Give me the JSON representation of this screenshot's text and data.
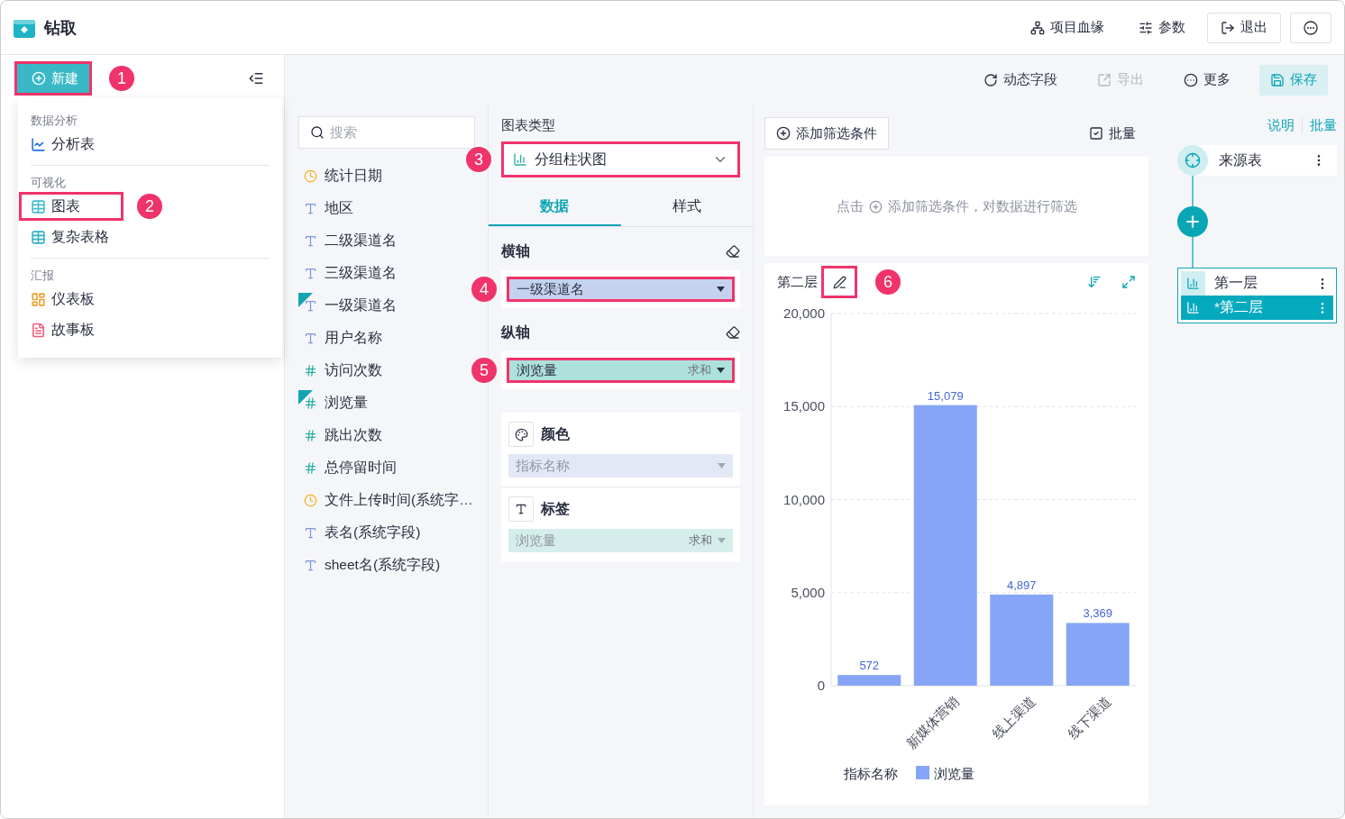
{
  "window": {
    "title": "钻取"
  },
  "header_actions": [
    {
      "kind": "lineage",
      "label": "项目血缘"
    },
    {
      "kind": "params",
      "label": "参数"
    },
    {
      "kind": "exit",
      "label": "退出"
    },
    {
      "kind": "more"
    }
  ],
  "new_button": {
    "label": "新建",
    "highlighted": true,
    "marker": "1"
  },
  "new_menu": [
    {
      "title": "数据分析",
      "items": [
        {
          "kind": "analysis",
          "label": "分析表",
          "highlighted": false
        }
      ]
    },
    {
      "title": "可视化",
      "items": [
        {
          "kind": "chart",
          "label": "图表",
          "highlighted": true,
          "marker": "2"
        },
        {
          "kind": "complex",
          "label": "复杂表格",
          "highlighted": false
        }
      ]
    },
    {
      "title": "汇报",
      "items": [
        {
          "kind": "dashboard",
          "label": "仪表板",
          "highlighted": false
        },
        {
          "kind": "story",
          "label": "故事板",
          "highlighted": false
        }
      ]
    }
  ],
  "toolbar": [
    {
      "kind": "dynamic",
      "label": "动态字段",
      "disabled": false
    },
    {
      "kind": "export",
      "label": "导出",
      "disabled": true
    },
    {
      "kind": "more",
      "label": "更多",
      "disabled": false
    },
    {
      "kind": "save",
      "label": "保存",
      "disabled": false
    }
  ],
  "fields": {
    "search": {
      "placeholder": "搜索"
    },
    "items": [
      {
        "kind": "date",
        "label": "统计日期",
        "used": false
      },
      {
        "kind": "text",
        "label": "地区",
        "used": false
      },
      {
        "kind": "text",
        "label": "二级渠道名",
        "used": false
      },
      {
        "kind": "text",
        "label": "三级渠道名",
        "used": false
      },
      {
        "kind": "text",
        "label": "一级渠道名",
        "used": true
      },
      {
        "kind": "text",
        "label": "用户名称",
        "used": false
      },
      {
        "kind": "number",
        "label": "访问次数",
        "used": false
      },
      {
        "kind": "number",
        "label": "浏览量",
        "used": true
      },
      {
        "kind": "number",
        "label": "跳出次数",
        "used": false
      },
      {
        "kind": "number",
        "label": "总停留时间",
        "used": false
      },
      {
        "kind": "date",
        "label": "文件上传时间(系统字…",
        "used": false
      },
      {
        "kind": "text",
        "label": "表名(系统字段)",
        "used": false
      },
      {
        "kind": "text",
        "label": "sheet名(系统字段)",
        "used": false
      }
    ]
  },
  "config": {
    "chart_type_label": "图表类型",
    "chart_type": {
      "value": "分组柱状图",
      "highlighted": true,
      "marker": "3"
    },
    "tabs": [
      {
        "label": "数据",
        "selected": true
      },
      {
        "label": "样式",
        "selected": false
      }
    ],
    "axes": [
      {
        "title": "横轴",
        "field": {
          "kind": "dimension",
          "label": "一级渠道名",
          "highlighted": true,
          "marker": "4"
        }
      },
      {
        "title": "纵轴",
        "field": {
          "kind": "measure",
          "label": "浏览量",
          "aggregation": "求和",
          "highlighted": true,
          "marker": "5"
        }
      }
    ],
    "properties": [
      {
        "kind": "color",
        "title": "颜色",
        "field": {
          "kind": "dimension",
          "label": "指标名称"
        }
      },
      {
        "kind": "label",
        "title": "标签",
        "field": {
          "kind": "measure",
          "label": "浏览量",
          "aggregation": "求和"
        }
      }
    ]
  },
  "filter": {
    "add_button": "添加筛选条件",
    "batch": "批量",
    "hint_before": "点击",
    "hint_after": "添加筛选条件，对数据进行筛选"
  },
  "chart": {
    "title": "第二层",
    "edit_highlighted": true,
    "marker": "6",
    "chart_data": {
      "type": "bar",
      "grid": true,
      "categories": [
        null,
        "新媒体营销",
        "线上渠道",
        "线下渠道"
      ],
      "series": [
        {
          "name": "浏览量",
          "color": "#86a5f7",
          "values": [
            572,
            15079,
            4897,
            3369
          ]
        }
      ],
      "ylim": [
        0,
        20000
      ],
      "yticks": [
        0,
        {
          "value": 5000,
          "label": "5,000"
        },
        {
          "value": 10000,
          "label": "10,000"
        },
        {
          "value": 15000,
          "label": "15,000"
        },
        {
          "value": 20000,
          "label": "20,000"
        }
      ],
      "value_labels": [
        "572",
        "15,079",
        "4,897",
        "3,369"
      ],
      "legend_title": "指标名称"
    }
  },
  "layers": {
    "links": [
      "说明",
      "批量"
    ],
    "source": "来源表",
    "items": [
      {
        "label": "第一层",
        "selected": false
      },
      {
        "label": "*第二层",
        "selected": true
      }
    ]
  }
}
